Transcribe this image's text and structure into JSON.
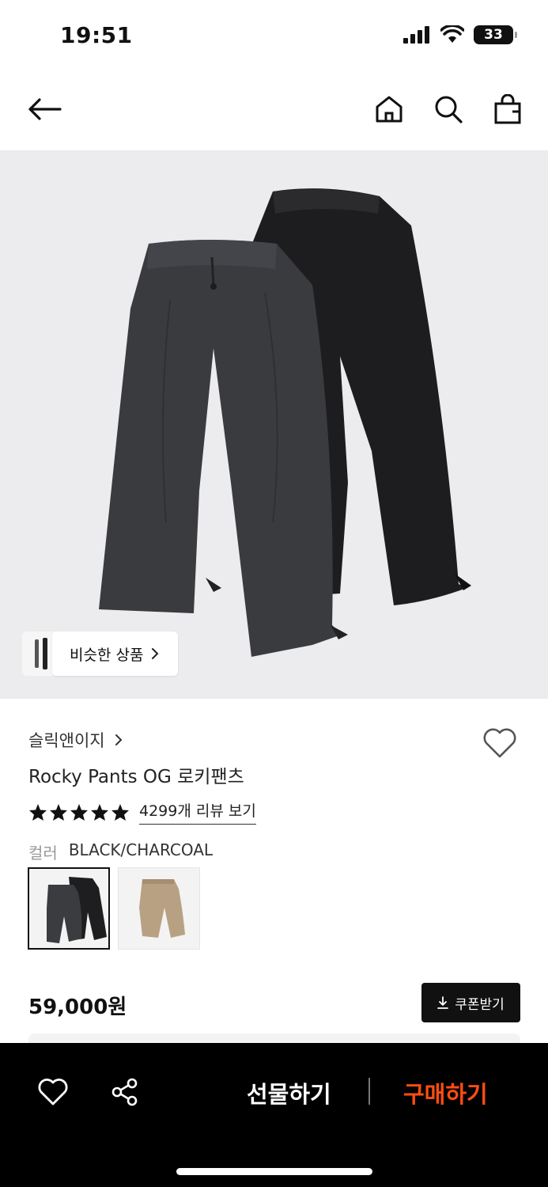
{
  "status": {
    "time": "19:51",
    "battery": "33"
  },
  "header": {
    "back_icon": "arrow-left-icon",
    "home_icon": "home-icon",
    "search_icon": "search-icon",
    "bag_icon": "shopping-bag-icon"
  },
  "hero": {
    "image": "black-and-charcoal-pants-photo",
    "similar_label": "비슷한 상품"
  },
  "product": {
    "brand": "슬릭앤이지",
    "name": "Rocky Pants OG 로키팬츠",
    "rating_stars": 5,
    "review_link": "4299개 리뷰 보기",
    "color_label": "컬러",
    "color_value": "BLACK/CHARCOAL",
    "swatches": [
      {
        "name": "BLACK/CHARCOAL",
        "selected": true,
        "color": "#3a3b3f"
      },
      {
        "name": "beige",
        "selected": false,
        "color": "#b8a183"
      }
    ],
    "price": "59,000원",
    "coupon_label": "쿠폰받기"
  },
  "bottom_bar": {
    "wish_icon": "heart-icon",
    "share_icon": "share-icon",
    "gift_label": "선물하기",
    "buy_label": "구매하기",
    "buy_color": "#ff4d11"
  }
}
